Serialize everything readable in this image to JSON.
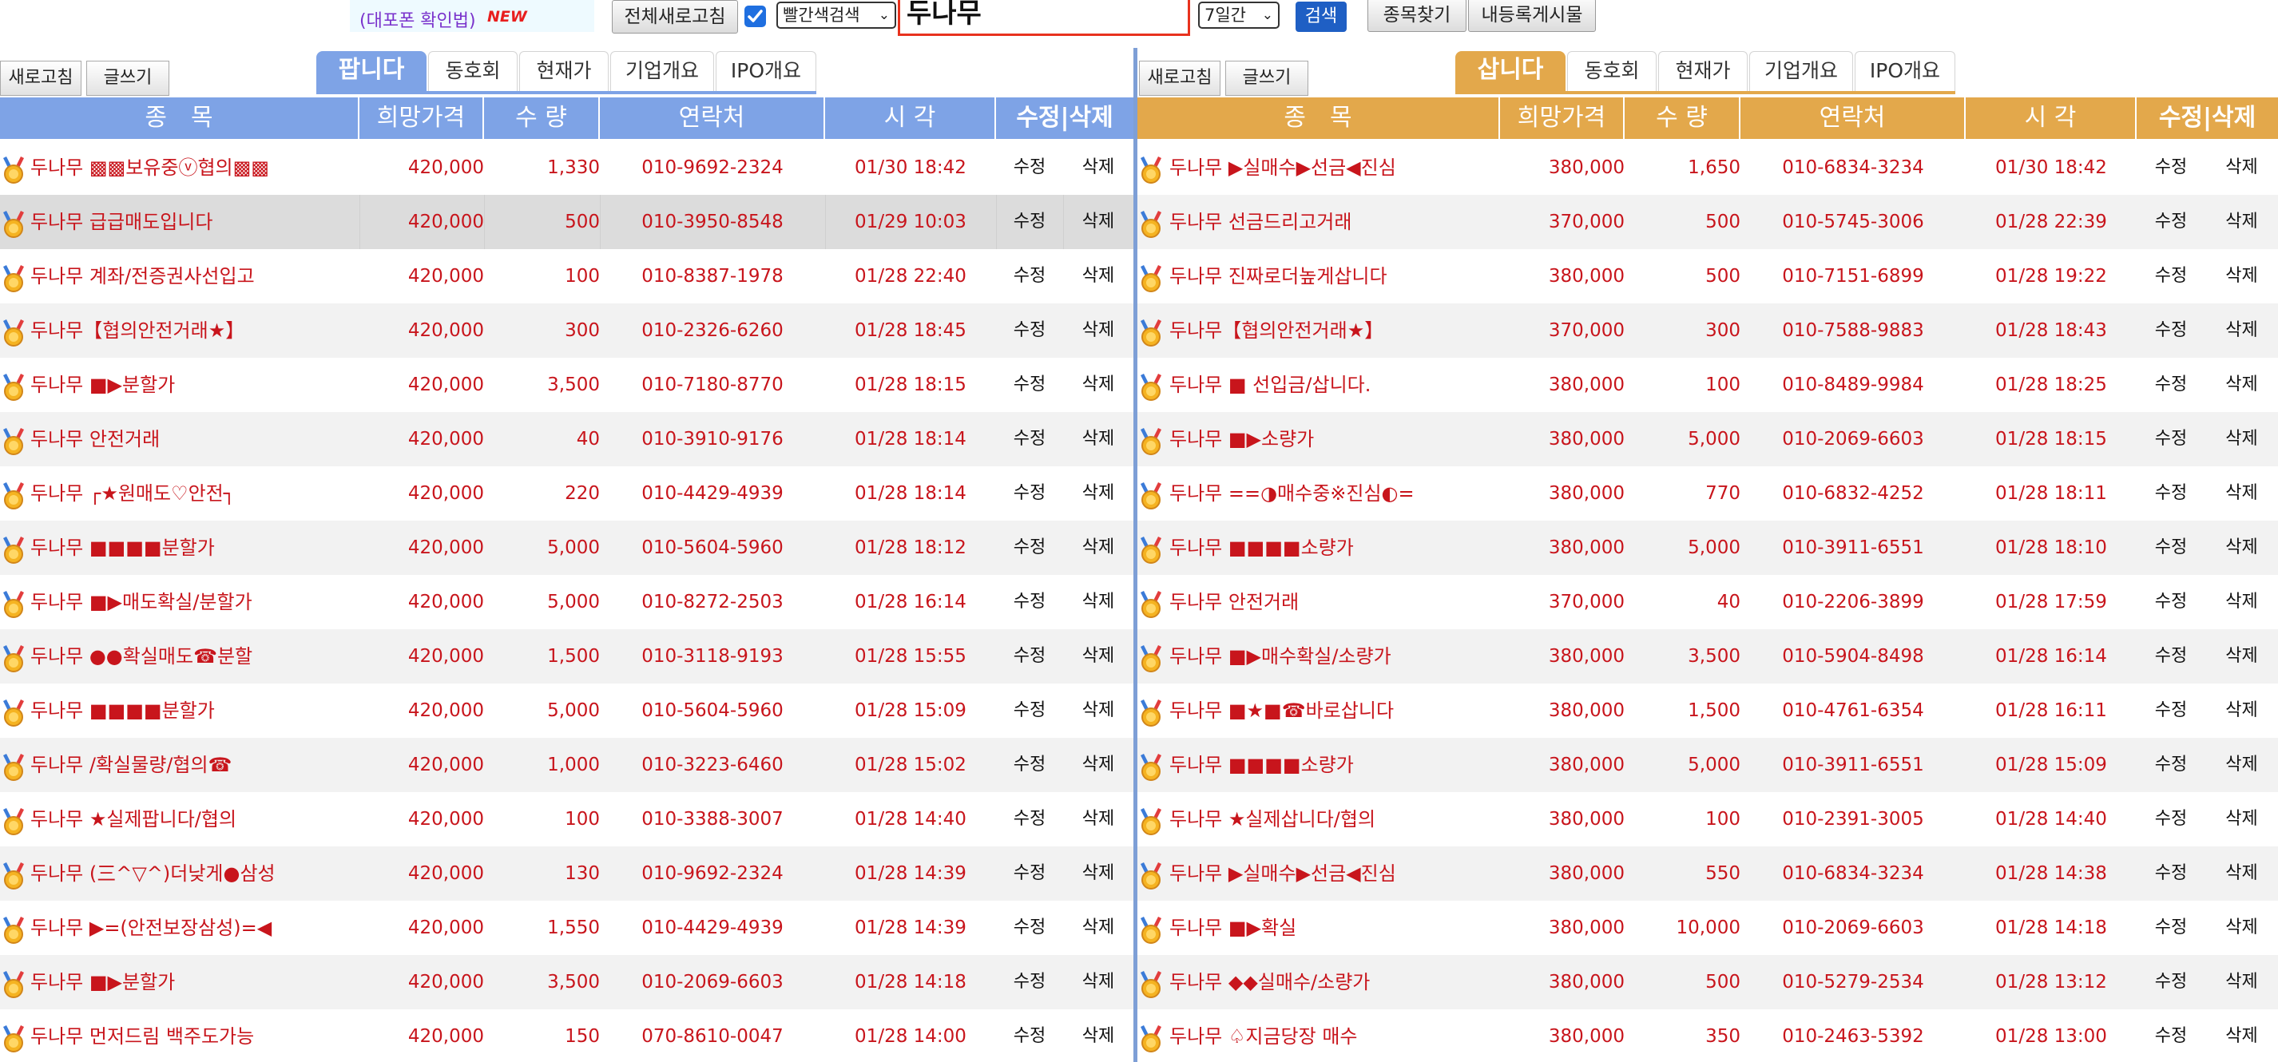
{
  "topbar": {
    "notice": "(대포폰 확인법)",
    "new_badge": "NEW",
    "refresh_all": "전체새로고침",
    "red_search": "빨간색검색",
    "query": "두나무",
    "period": "7일간",
    "search": "검색",
    "find_stock": "종목찾기",
    "my_posts": "내등록게시물"
  },
  "colors": {
    "sell_accent": "#7ea3e6",
    "buy_accent": "#e3a84b",
    "text_red": "#c8151c"
  },
  "headers": {
    "stock": "종　목",
    "price": "희망가격",
    "qty": "수 량",
    "contact": "연락처",
    "time": "시 각",
    "edit_delete": "수정|삭제"
  },
  "sell_panel": {
    "refresh": "새로고침",
    "write": "글쓰기",
    "tabs": [
      "팝니다",
      "동호회",
      "현재가",
      "기업개요",
      "IPO개요"
    ],
    "edit": "수정",
    "delete": "삭제",
    "rows": [
      {
        "name": "두나무 ▩▩보유중ⓥ협의▩▩",
        "price": "420,000",
        "qty": "1,330",
        "contact": "010-9692-2324",
        "time": "01/30 18:42"
      },
      {
        "name": "두나무 급급매도입니다",
        "price": "420,000",
        "qty": "500",
        "contact": "010-3950-8548",
        "time": "01/29 10:03"
      },
      {
        "name": "두나무 계좌/전증권사선입고",
        "price": "420,000",
        "qty": "100",
        "contact": "010-8387-1978",
        "time": "01/28 22:40"
      },
      {
        "name": "두나무【협의안전거래★】",
        "price": "420,000",
        "qty": "300",
        "contact": "010-2326-6260",
        "time": "01/28 18:45"
      },
      {
        "name": "두나무 ■▶분할가",
        "price": "420,000",
        "qty": "3,500",
        "contact": "010-7180-8770",
        "time": "01/28 18:15"
      },
      {
        "name": "두나무 안전거래",
        "price": "420,000",
        "qty": "40",
        "contact": "010-3910-9176",
        "time": "01/28 18:14"
      },
      {
        "name": "두나무 ┌★원매도♡안전┐",
        "price": "420,000",
        "qty": "220",
        "contact": "010-4429-4939",
        "time": "01/28 18:14"
      },
      {
        "name": "두나무 ■■■■분할가",
        "price": "420,000",
        "qty": "5,000",
        "contact": "010-5604-5960",
        "time": "01/28 18:12"
      },
      {
        "name": "두나무 ■▶매도확실/분할가",
        "price": "420,000",
        "qty": "5,000",
        "contact": "010-8272-2503",
        "time": "01/28 16:14"
      },
      {
        "name": "두나무 ●●확실매도☎분할",
        "price": "420,000",
        "qty": "1,500",
        "contact": "010-3118-9193",
        "time": "01/28 15:55"
      },
      {
        "name": "두나무 ■■■■분할가",
        "price": "420,000",
        "qty": "5,000",
        "contact": "010-5604-5960",
        "time": "01/28 15:09"
      },
      {
        "name": "두나무 /확실물량/협의☎",
        "price": "420,000",
        "qty": "1,000",
        "contact": "010-3223-6460",
        "time": "01/28 15:02"
      },
      {
        "name": "두나무 ★실제팝니다/협의",
        "price": "420,000",
        "qty": "100",
        "contact": "010-3388-3007",
        "time": "01/28 14:40"
      },
      {
        "name": "두나무 (三^▽^)더낮게●삼성",
        "price": "420,000",
        "qty": "130",
        "contact": "010-9692-2324",
        "time": "01/28 14:39"
      },
      {
        "name": "두나무 ▶=(안전보장삼성)=◀",
        "price": "420,000",
        "qty": "1,550",
        "contact": "010-4429-4939",
        "time": "01/28 14:39"
      },
      {
        "name": "두나무 ■▶분할가",
        "price": "420,000",
        "qty": "3,500",
        "contact": "010-2069-6603",
        "time": "01/28 14:18"
      },
      {
        "name": "두나무 먼저드림 백주도가능",
        "price": "420,000",
        "qty": "150",
        "contact": "070-8610-0047",
        "time": "01/28 14:00"
      }
    ]
  },
  "buy_panel": {
    "refresh": "새로고침",
    "write": "글쓰기",
    "tabs": [
      "삽니다",
      "동호회",
      "현재가",
      "기업개요",
      "IPO개요"
    ],
    "edit": "수정",
    "delete": "삭제",
    "rows": [
      {
        "name": "두나무 ▶실매수▶선금◀진심",
        "price": "380,000",
        "qty": "1,650",
        "contact": "010-6834-3234",
        "time": "01/30 18:42"
      },
      {
        "name": "두나무 선금드리고거래",
        "price": "370,000",
        "qty": "500",
        "contact": "010-5745-3006",
        "time": "01/28 22:39"
      },
      {
        "name": "두나무 진짜로더높게삽니다",
        "price": "380,000",
        "qty": "500",
        "contact": "010-7151-6899",
        "time": "01/28 19:22"
      },
      {
        "name": "두나무【협의안전거래★】",
        "price": "370,000",
        "qty": "300",
        "contact": "010-7588-9883",
        "time": "01/28 18:43"
      },
      {
        "name": "두나무 ■ 선입금/삽니다.",
        "price": "380,000",
        "qty": "100",
        "contact": "010-8489-9984",
        "time": "01/28 18:25"
      },
      {
        "name": "두나무 ■▶소량가",
        "price": "380,000",
        "qty": "5,000",
        "contact": "010-2069-6603",
        "time": "01/28 18:15"
      },
      {
        "name": "두나무 ==◑매수중※진심◐=",
        "price": "380,000",
        "qty": "770",
        "contact": "010-6832-4252",
        "time": "01/28 18:11"
      },
      {
        "name": "두나무 ■■■■소량가",
        "price": "380,000",
        "qty": "5,000",
        "contact": "010-3911-6551",
        "time": "01/28 18:10"
      },
      {
        "name": "두나무 안전거래",
        "price": "370,000",
        "qty": "40",
        "contact": "010-2206-3899",
        "time": "01/28 17:59"
      },
      {
        "name": "두나무 ■▶매수확실/소량가",
        "price": "380,000",
        "qty": "3,500",
        "contact": "010-5904-8498",
        "time": "01/28 16:14"
      },
      {
        "name": "두나무 ■★■☎바로삽니다",
        "price": "380,000",
        "qty": "1,500",
        "contact": "010-4761-6354",
        "time": "01/28 16:11"
      },
      {
        "name": "두나무 ■■■■소량가",
        "price": "380,000",
        "qty": "5,000",
        "contact": "010-3911-6551",
        "time": "01/28 15:09"
      },
      {
        "name": "두나무 ★실제삽니다/협의",
        "price": "380,000",
        "qty": "100",
        "contact": "010-2391-3005",
        "time": "01/28 14:40"
      },
      {
        "name": "두나무 ▶실매수▶선금◀진심",
        "price": "380,000",
        "qty": "550",
        "contact": "010-6834-3234",
        "time": "01/28 14:38"
      },
      {
        "name": "두나무 ■▶확실",
        "price": "380,000",
        "qty": "10,000",
        "contact": "010-2069-6603",
        "time": "01/28 14:18"
      },
      {
        "name": "두나무 ◆◆실매수/소량가",
        "price": "380,000",
        "qty": "500",
        "contact": "010-5279-2534",
        "time": "01/28 13:12"
      },
      {
        "name": "두나무 ♤지금당장 매수",
        "price": "380,000",
        "qty": "350",
        "contact": "010-2463-5392",
        "time": "01/28 13:00"
      }
    ]
  }
}
